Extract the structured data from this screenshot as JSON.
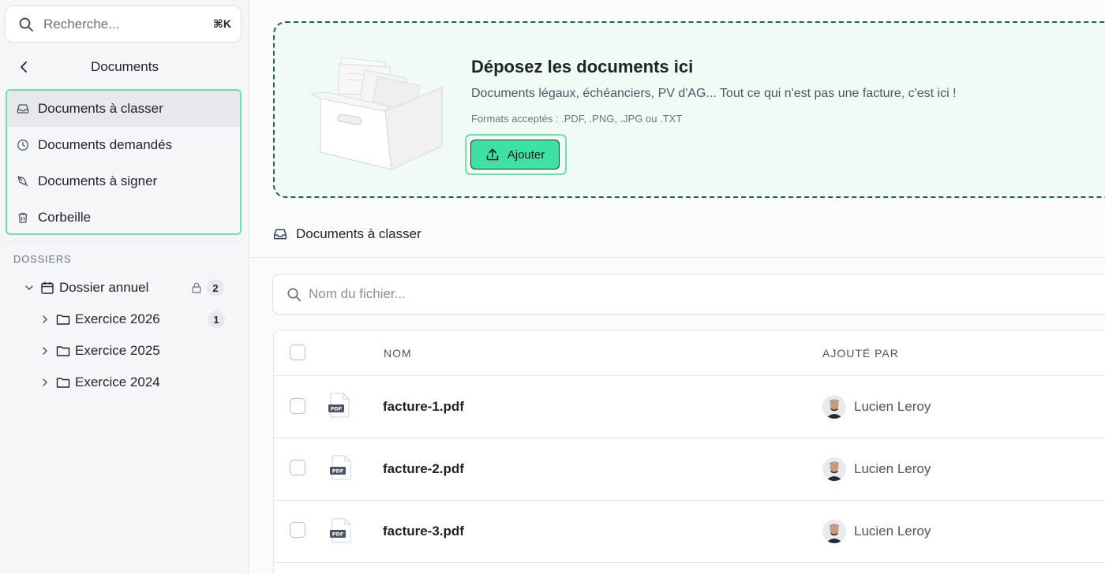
{
  "sidebar": {
    "search": {
      "placeholder": "Recherche...",
      "shortcut": "⌘K"
    },
    "section_title": "Documents",
    "nav": [
      {
        "label": "Documents à classer",
        "icon": "inbox-icon",
        "active": true
      },
      {
        "label": "Documents demandés",
        "icon": "clock-icon",
        "active": false
      },
      {
        "label": "Documents à signer",
        "icon": "pen-icon",
        "active": false
      },
      {
        "label": "Corbeille",
        "icon": "trash-icon",
        "active": false
      }
    ],
    "dossiers_label": "DOSSIERS",
    "tree": [
      {
        "label": "Dossier annuel",
        "icon": "calendar-icon",
        "expanded": true,
        "locked": true,
        "badge": "2"
      },
      {
        "label": "Exercice 2026",
        "icon": "folder-icon",
        "expanded": false,
        "badge": "1"
      },
      {
        "label": "Exercice 2025",
        "icon": "folder-icon",
        "expanded": false,
        "badge": ""
      },
      {
        "label": "Exercice 2024",
        "icon": "folder-icon",
        "expanded": false,
        "badge": ""
      }
    ]
  },
  "dropzone": {
    "title": "Déposez les documents ici",
    "description": "Documents légaux, échéanciers, PV d'AG... Tout ce qui n'est pas une facture, c'est ici !",
    "formats": "Formats acceptés : .PDF, .PNG, .JPG ou .TXT",
    "add_label": "Ajouter"
  },
  "list": {
    "title": "Documents à classer",
    "search_placeholder": "Nom du fichier...",
    "columns": {
      "name": "NOM",
      "added_by": "AJOUTÉ PAR"
    },
    "rows": [
      {
        "file": "facture-1.pdf",
        "added_by": "Lucien Leroy",
        "badge": "PDF"
      },
      {
        "file": "facture-2.pdf",
        "added_by": "Lucien Leroy",
        "badge": "PDF"
      },
      {
        "file": "facture-3.pdf",
        "added_by": "Lucien Leroy",
        "badge": "PDF"
      }
    ]
  },
  "colors": {
    "accent": "#3fe0a4",
    "focus_ring": "#6fe0ad",
    "dropzone_border": "#1e6b45",
    "dropzone_bg": "#f1fbf6"
  }
}
